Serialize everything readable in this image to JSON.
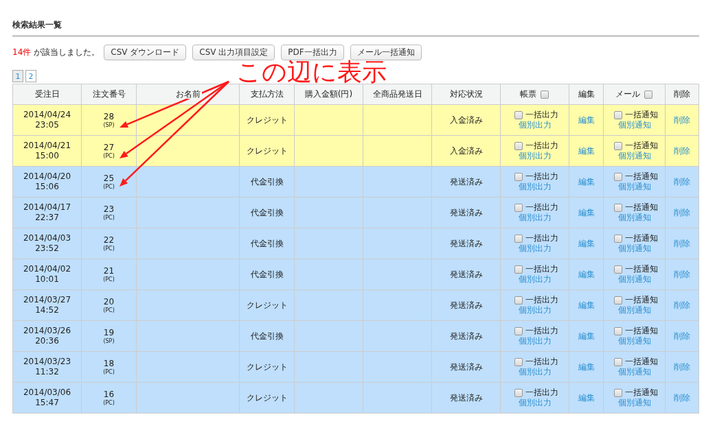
{
  "section_title": "検索結果一覧",
  "result": {
    "count": "14件",
    "text": "が該当しました。"
  },
  "buttons": [
    "CSV ダウンロード",
    "CSV 出力項目設定",
    "PDF一括出力",
    "メール一括通知"
  ],
  "pages": [
    {
      "label": "1",
      "selected": true
    },
    {
      "label": "2",
      "selected": false
    }
  ],
  "annotation": {
    "text": "この辺に表示"
  },
  "columns": [
    {
      "label": "受注日"
    },
    {
      "label": "注文番号"
    },
    {
      "label": "お名前"
    },
    {
      "label": "支払方法"
    },
    {
      "label": "購入金額(円)"
    },
    {
      "label": "全商品発送日"
    },
    {
      "label": "対応状況"
    },
    {
      "label": "帳票",
      "checked": false
    },
    {
      "label": "編集"
    },
    {
      "label": "メール",
      "checked": false
    },
    {
      "label": "削除"
    }
  ],
  "rows": [
    {
      "date": "2014/04/24",
      "time": "23:05",
      "order": "28",
      "device": "(SP)",
      "payment": "クレジット",
      "status": "入金済み",
      "color": "#fffcaa",
      "pdf_checked": false,
      "pdf_label": "一括出力",
      "pdf_link": "個別出力",
      "edit": "編集",
      "mail_checked": false,
      "mail_label": "一括通知",
      "mail_link": "個別通知",
      "delete": "削除"
    },
    {
      "date": "2014/04/21",
      "time": "15:00",
      "order": "27",
      "device": "(PC)",
      "payment": "クレジット",
      "status": "入金済み",
      "color": "#fffcaa",
      "pdf_checked": false,
      "pdf_label": "一括出力",
      "pdf_link": "個別出力",
      "edit": "編集",
      "mail_checked": false,
      "mail_label": "一括通知",
      "mail_link": "個別通知",
      "delete": "削除"
    },
    {
      "date": "2014/04/20",
      "time": "15:06",
      "order": "25",
      "device": "(PC)",
      "payment": "代金引換",
      "status": "発送済み",
      "color": "#bfdffc",
      "pdf_checked": false,
      "pdf_label": "一括出力",
      "pdf_link": "個別出力",
      "edit": "編集",
      "mail_checked": false,
      "mail_label": "一括通知",
      "mail_link": "個別通知",
      "delete": "削除"
    },
    {
      "date": "2014/04/17",
      "time": "22:37",
      "order": "23",
      "device": "(PC)",
      "payment": "代金引換",
      "status": "発送済み",
      "color": "#bfdffc",
      "pdf_checked": false,
      "pdf_label": "一括出力",
      "pdf_link": "個別出力",
      "edit": "編集",
      "mail_checked": false,
      "mail_label": "一括通知",
      "mail_link": "個別通知",
      "delete": "削除"
    },
    {
      "date": "2014/04/03",
      "time": "23:52",
      "order": "22",
      "device": "(PC)",
      "payment": "代金引換",
      "status": "発送済み",
      "color": "#bfdffc",
      "pdf_checked": false,
      "pdf_label": "一括出力",
      "pdf_link": "個別出力",
      "edit": "編集",
      "mail_checked": false,
      "mail_label": "一括通知",
      "mail_link": "個別通知",
      "delete": "削除"
    },
    {
      "date": "2014/04/02",
      "time": "10:01",
      "order": "21",
      "device": "(PC)",
      "payment": "代金引換",
      "status": "発送済み",
      "color": "#bfdffc",
      "pdf_checked": false,
      "pdf_label": "一括出力",
      "pdf_link": "個別出力",
      "edit": "編集",
      "mail_checked": false,
      "mail_label": "一括通知",
      "mail_link": "個別通知",
      "delete": "削除"
    },
    {
      "date": "2014/03/27",
      "time": "14:52",
      "order": "20",
      "device": "(PC)",
      "payment": "クレジット",
      "status": "発送済み",
      "color": "#bfdffc",
      "pdf_checked": false,
      "pdf_label": "一括出力",
      "pdf_link": "個別出力",
      "edit": "編集",
      "mail_checked": false,
      "mail_label": "一括通知",
      "mail_link": "個別通知",
      "delete": "削除"
    },
    {
      "date": "2014/03/26",
      "time": "20:36",
      "order": "19",
      "device": "(SP)",
      "payment": "代金引換",
      "status": "発送済み",
      "color": "#bfdffc",
      "pdf_checked": false,
      "pdf_label": "一括出力",
      "pdf_link": "個別出力",
      "edit": "編集",
      "mail_checked": false,
      "mail_label": "一括通知",
      "mail_link": "個別通知",
      "delete": "削除"
    },
    {
      "date": "2014/03/23",
      "time": "11:32",
      "order": "18",
      "device": "(PC)",
      "payment": "クレジット",
      "status": "発送済み",
      "color": "#bfdffc",
      "pdf_checked": false,
      "pdf_label": "一括出力",
      "pdf_link": "個別出力",
      "edit": "編集",
      "mail_checked": false,
      "mail_label": "一括通知",
      "mail_link": "個別通知",
      "delete": "削除"
    },
    {
      "date": "2014/03/06",
      "time": "15:47",
      "order": "16",
      "device": "(PC)",
      "payment": "クレジット",
      "status": "発送済み",
      "color": "#bfdffc",
      "pdf_checked": false,
      "pdf_label": "一括出力",
      "pdf_link": "個別出力",
      "edit": "編集",
      "mail_checked": false,
      "mail_label": "一括通知",
      "mail_link": "個別通知",
      "delete": "削除"
    }
  ]
}
